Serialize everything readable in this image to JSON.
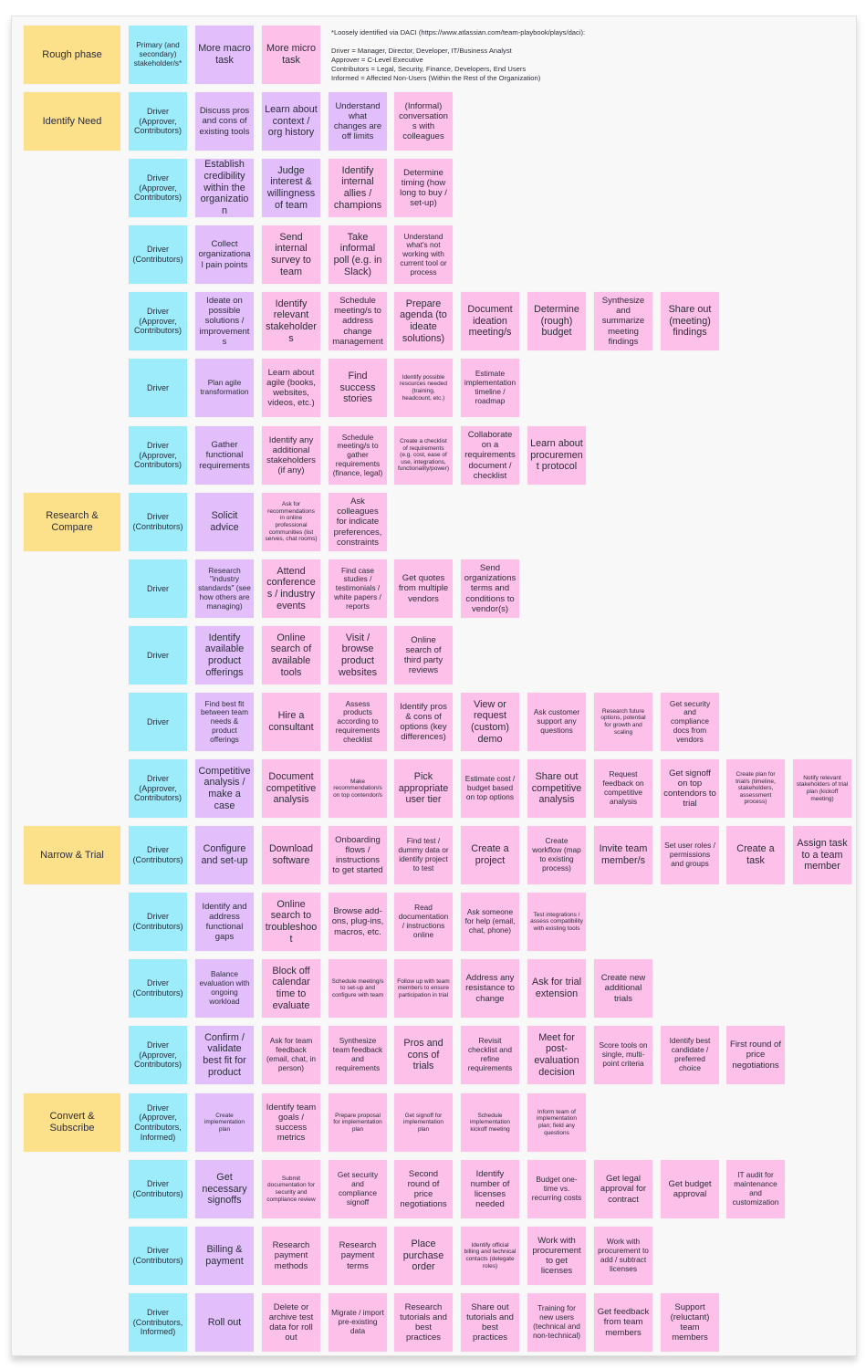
{
  "legend": {
    "title": "*Loosely identified via DACI (https://www.atlassian.com/team-playbook/plays/daci):",
    "lines": [
      "Driver = Manager, Director, Developer, IT/Business Analyst",
      "Approver = C-Level Executive",
      "Contributors = Legal, Security, Finance, Developers, End Users",
      "Informed = Affected Non-Users (Within the Rest of the Organization)"
    ]
  },
  "colors": {
    "phase": "#fde08a",
    "stakeholder": "#9cecfb",
    "macro_task": "#e2bffb",
    "micro_task": "#fdc0e8",
    "board": "#f8f8f8"
  },
  "header": {
    "phase": "Rough phase",
    "stakeholder": "Primary (and secondary) stakeholder/s*",
    "macro": "More macro task",
    "micro": "More micro task"
  },
  "rows": [
    {
      "phase": "Identify Need",
      "stakeholder": "Driver (Approver, Contributors)",
      "tasks": [
        {
          "text": "Discuss pros and cons of existing tools",
          "type": "macro",
          "size": "md"
        },
        {
          "text": "Learn about context / org history",
          "type": "macro",
          "size": "lg"
        },
        {
          "text": "Understand what changes are off limits",
          "type": "macro",
          "size": "md"
        },
        {
          "text": "(Informal) conversations with colleagues",
          "type": "micro",
          "size": "md"
        }
      ]
    },
    {
      "phase": "",
      "stakeholder": "Driver (Approver, Contributors)",
      "tasks": [
        {
          "text": "Establish credibility within the organization",
          "type": "macro",
          "size": "lg"
        },
        {
          "text": "Judge interest & willingness of team",
          "type": "macro",
          "size": "lg"
        },
        {
          "text": "Identify internal allies / champions",
          "type": "micro",
          "size": "lg"
        },
        {
          "text": "Determine timing (how long to buy / set-up)",
          "type": "micro",
          "size": "md"
        }
      ]
    },
    {
      "phase": "",
      "stakeholder": "Driver (Contributors)",
      "tasks": [
        {
          "text": "Collect organizational pain points",
          "type": "macro",
          "size": "md"
        },
        {
          "text": "Send internal survey to team",
          "type": "micro",
          "size": "lg"
        },
        {
          "text": "Take informal poll (e.g. in Slack)",
          "type": "micro",
          "size": "lg"
        },
        {
          "text": "Understand what's not working with current tool or process",
          "type": "micro",
          "size": "sm"
        }
      ]
    },
    {
      "phase": "",
      "stakeholder": "Driver (Approver, Contributors)",
      "tasks": [
        {
          "text": "Ideate on possible solutions / improvements",
          "type": "macro",
          "size": "md"
        },
        {
          "text": "Identify relevant stakeholders",
          "type": "micro",
          "size": "lg"
        },
        {
          "text": "Schedule meeting/s to address change management",
          "type": "micro",
          "size": "md"
        },
        {
          "text": "Prepare agenda (to ideate solutions)",
          "type": "micro",
          "size": "lg"
        },
        {
          "text": "Document ideation meeting/s",
          "type": "micro",
          "size": "lg"
        },
        {
          "text": "Determine (rough) budget",
          "type": "micro",
          "size": "lg"
        },
        {
          "text": "Synthesize and summarize meeting findings",
          "type": "micro",
          "size": "md"
        },
        {
          "text": "Share out (meeting) findings",
          "type": "micro",
          "size": "lg"
        }
      ]
    },
    {
      "phase": "",
      "stakeholder": "Driver",
      "tasks": [
        {
          "text": "Plan agile transformation",
          "type": "macro",
          "size": "sm"
        },
        {
          "text": "Learn about agile (books, websites, videos, etc.)",
          "type": "micro",
          "size": "md"
        },
        {
          "text": "Find success stories",
          "type": "micro",
          "size": "lg"
        },
        {
          "text": "Identify possible resources needed (training, headcount, etc.)",
          "type": "micro",
          "size": "xs"
        },
        {
          "text": "Estimate implementation timeline / roadmap",
          "type": "micro",
          "size": "sm"
        }
      ]
    },
    {
      "phase": "",
      "stakeholder": "Driver (Approver, Contributors)",
      "tasks": [
        {
          "text": "Gather functional requirements",
          "type": "macro",
          "size": "md"
        },
        {
          "text": "Identify any additional stakeholders (if any)",
          "type": "micro",
          "size": "md"
        },
        {
          "text": "Schedule meeting/s to gather requirements (finance, legal)",
          "type": "micro",
          "size": "sm"
        },
        {
          "text": "Create a checklist of requirements (e.g. cost, ease of use, integrations, functionality/power)",
          "type": "micro",
          "size": "xs"
        },
        {
          "text": "Collaborate on a requirements document / checklist",
          "type": "micro",
          "size": "md"
        },
        {
          "text": "Learn about procurement protocol",
          "type": "micro",
          "size": "lg"
        }
      ]
    },
    {
      "phase": "Research & Compare",
      "stakeholder": "Driver (Contributors)",
      "tasks": [
        {
          "text": "Solicit advice",
          "type": "macro",
          "size": "lg"
        },
        {
          "text": "Ask for recommendations in online professional communities (list serves, chat rooms)",
          "type": "micro",
          "size": "xs"
        },
        {
          "text": "Ask colleagues for indicate preferences, constraints",
          "type": "micro",
          "size": "md"
        }
      ]
    },
    {
      "phase": "",
      "stakeholder": "Driver",
      "tasks": [
        {
          "text": "Research \"industry standards\" (see how others are managing)",
          "type": "macro",
          "size": "sm"
        },
        {
          "text": "Attend conferences / industry events",
          "type": "micro",
          "size": "lg"
        },
        {
          "text": "Find case studies / testimonials / white papers / reports",
          "type": "micro",
          "size": "sm"
        },
        {
          "text": "Get quotes from multiple vendors",
          "type": "micro",
          "size": "md"
        },
        {
          "text": "Send organizations terms and conditions to vendor(s)",
          "type": "micro",
          "size": "md"
        }
      ]
    },
    {
      "phase": "",
      "stakeholder": "Driver",
      "tasks": [
        {
          "text": "Identify available product offerings",
          "type": "macro",
          "size": "lg"
        },
        {
          "text": "Online search of available tools",
          "type": "micro",
          "size": "lg"
        },
        {
          "text": "Visit / browse product websites",
          "type": "micro",
          "size": "lg"
        },
        {
          "text": "Online search of third party reviews",
          "type": "micro",
          "size": "md"
        }
      ]
    },
    {
      "phase": "",
      "stakeholder": "Driver",
      "tasks": [
        {
          "text": "Find best fit between team needs & product offerings",
          "type": "macro",
          "size": "sm"
        },
        {
          "text": "Hire a consultant",
          "type": "micro",
          "size": "lg"
        },
        {
          "text": "Assess products according to requirements checklist",
          "type": "micro",
          "size": "sm"
        },
        {
          "text": "Identify pros & cons of options (key differences)",
          "type": "micro",
          "size": "md"
        },
        {
          "text": "View or request (custom) demo",
          "type": "micro",
          "size": "lg"
        },
        {
          "text": "Ask customer support any questions",
          "type": "micro",
          "size": "sm"
        },
        {
          "text": "Research future options, potential for growth and scaling",
          "type": "micro",
          "size": "xs"
        },
        {
          "text": "Get security and compliance docs from vendors",
          "type": "micro",
          "size": "sm"
        }
      ]
    },
    {
      "phase": "",
      "stakeholder": "Driver (Approver, Contributors)",
      "tasks": [
        {
          "text": "Competitive analysis / make a case",
          "type": "macro",
          "size": "lg"
        },
        {
          "text": "Document competitive analysis",
          "type": "micro",
          "size": "lg"
        },
        {
          "text": "Make recommendation/s on top contendor/s",
          "type": "micro",
          "size": "xs"
        },
        {
          "text": "Pick appropriate user tier",
          "type": "micro",
          "size": "lg"
        },
        {
          "text": "Estimate cost / budget based on top options",
          "type": "micro",
          "size": "sm"
        },
        {
          "text": "Share out competitive analysis",
          "type": "micro",
          "size": "lg"
        },
        {
          "text": "Request feedback on competitive analysis",
          "type": "micro",
          "size": "sm"
        },
        {
          "text": "Get signoff on top contendors to trial",
          "type": "micro",
          "size": "md"
        },
        {
          "text": "Create plan for trial/s (timeline, stakeholders, assessment process)",
          "type": "micro",
          "size": "xs"
        },
        {
          "text": "Notify relevant stakeholders of trial plan (kickoff meeting)",
          "type": "micro",
          "size": "xs"
        }
      ]
    },
    {
      "phase": "Narrow & Trial",
      "stakeholder": "Driver (Contributors)",
      "tasks": [
        {
          "text": "Configure and set-up",
          "type": "macro",
          "size": "lg"
        },
        {
          "text": "Download software",
          "type": "micro",
          "size": "lg"
        },
        {
          "text": "Onboarding flows / instructions to get started",
          "type": "micro",
          "size": "md"
        },
        {
          "text": "Find test / dummy data or identify project to test",
          "type": "micro",
          "size": "sm"
        },
        {
          "text": "Create a project",
          "type": "micro",
          "size": "lg"
        },
        {
          "text": "Create workflow (map to existing process)",
          "type": "micro",
          "size": "sm"
        },
        {
          "text": "Invite team member/s",
          "type": "micro",
          "size": "lg"
        },
        {
          "text": "Set user roles / permissions and groups",
          "type": "micro",
          "size": "sm"
        },
        {
          "text": "Create a task",
          "type": "micro",
          "size": "lg"
        },
        {
          "text": "Assign task to a team member",
          "type": "micro",
          "size": "lg"
        }
      ]
    },
    {
      "phase": "",
      "stakeholder": "Driver (Contributors)",
      "tasks": [
        {
          "text": "Identify and address functional gaps",
          "type": "macro",
          "size": "md"
        },
        {
          "text": "Online search to troubleshoot",
          "type": "micro",
          "size": "lg"
        },
        {
          "text": "Browse add-ons, plug-ins, macros, etc.",
          "type": "micro",
          "size": "md"
        },
        {
          "text": "Read documentation / instructions online",
          "type": "micro",
          "size": "sm"
        },
        {
          "text": "Ask someone for help (email, chat, phone)",
          "type": "micro",
          "size": "sm"
        },
        {
          "text": "Test integrations / assess compatibility with existing tools",
          "type": "micro",
          "size": "xs"
        }
      ]
    },
    {
      "phase": "",
      "stakeholder": "Driver (Contributors)",
      "tasks": [
        {
          "text": "Balance evaluation with ongoing workload",
          "type": "macro",
          "size": "sm"
        },
        {
          "text": "Block off calendar time to evaluate",
          "type": "micro",
          "size": "lg"
        },
        {
          "text": "Schedule meeting/s to set-up and configure with team",
          "type": "micro",
          "size": "xs"
        },
        {
          "text": "Follow up with team members to ensure participation in trial",
          "type": "micro",
          "size": "xs"
        },
        {
          "text": "Address any resistance to change",
          "type": "micro",
          "size": "md"
        },
        {
          "text": "Ask for trial extension",
          "type": "micro",
          "size": "lg"
        },
        {
          "text": "Create new additional trials",
          "type": "micro",
          "size": "md"
        }
      ]
    },
    {
      "phase": "",
      "stakeholder": "Driver (Approver, Contributors)",
      "tasks": [
        {
          "text": "Confirm / validate best fit for product",
          "type": "macro",
          "size": "lg"
        },
        {
          "text": "Ask for team feedback (email, chat, in person)",
          "type": "micro",
          "size": "sm"
        },
        {
          "text": "Synthesize team feedback and requirements",
          "type": "micro",
          "size": "sm"
        },
        {
          "text": "Pros and cons of trials",
          "type": "micro",
          "size": "lg"
        },
        {
          "text": "Revisit checklist and refine requirements",
          "type": "micro",
          "size": "sm"
        },
        {
          "text": "Meet for post-evaluation decision",
          "type": "micro",
          "size": "lg"
        },
        {
          "text": "Score tools on single, multi-point criteria",
          "type": "micro",
          "size": "sm"
        },
        {
          "text": "Identify best candidate / preferred choice",
          "type": "micro",
          "size": "sm"
        },
        {
          "text": "First round of price negotiations",
          "type": "micro",
          "size": "md"
        }
      ]
    },
    {
      "phase": "Convert & Subscribe",
      "stakeholder": "Driver (Approver, Contributors, Informed)",
      "tasks": [
        {
          "text": "Create implementation plan",
          "type": "macro",
          "size": "xs"
        },
        {
          "text": "Identify team goals / success metrics",
          "type": "micro",
          "size": "md"
        },
        {
          "text": "Prepare proposal for implementation plan",
          "type": "micro",
          "size": "xs"
        },
        {
          "text": "Get signoff for implementation plan",
          "type": "micro",
          "size": "xs"
        },
        {
          "text": "Schedule implementation kickoff meeting",
          "type": "micro",
          "size": "xs"
        },
        {
          "text": "Inform team of implementation plan; field any questions",
          "type": "micro",
          "size": "xs"
        }
      ]
    },
    {
      "phase": "",
      "stakeholder": "Driver (Contributors)",
      "tasks": [
        {
          "text": "Get necessary signoffs",
          "type": "macro",
          "size": "lg"
        },
        {
          "text": "Submit documentation for security and compliance review",
          "type": "micro",
          "size": "xs"
        },
        {
          "text": "Get security and compliance signoff",
          "type": "micro",
          "size": "sm"
        },
        {
          "text": "Second round of price negotiations",
          "type": "micro",
          "size": "md"
        },
        {
          "text": "Identify number of licenses needed",
          "type": "micro",
          "size": "md"
        },
        {
          "text": "Budget one-time vs. recurring costs",
          "type": "micro",
          "size": "sm"
        },
        {
          "text": "Get legal approval for contract",
          "type": "micro",
          "size": "md"
        },
        {
          "text": "Get budget approval",
          "type": "micro",
          "size": "md"
        },
        {
          "text": "IT audit for maintenance and customization",
          "type": "micro",
          "size": "sm"
        }
      ]
    },
    {
      "phase": "",
      "stakeholder": "Driver (Contributors)",
      "tasks": [
        {
          "text": "Billing & payment",
          "type": "macro",
          "size": "lg"
        },
        {
          "text": "Research payment methods",
          "type": "micro",
          "size": "md"
        },
        {
          "text": "Research payment terms",
          "type": "micro",
          "size": "md"
        },
        {
          "text": "Place purchase order",
          "type": "micro",
          "size": "lg"
        },
        {
          "text": "Identify official billing and technical contacts (delegate roles)",
          "type": "micro",
          "size": "xs"
        },
        {
          "text": "Work with procurement to get licenses",
          "type": "micro",
          "size": "md"
        },
        {
          "text": "Work with procurement to add / subtract licenses",
          "type": "micro",
          "size": "sm"
        }
      ]
    },
    {
      "phase": "",
      "stakeholder": "Driver (Contributors, Informed)",
      "tasks": [
        {
          "text": "Roll out",
          "type": "macro",
          "size": "lg"
        },
        {
          "text": "Delete or archive test data for roll out",
          "type": "micro",
          "size": "md"
        },
        {
          "text": "Migrate / import pre-existing data",
          "type": "micro",
          "size": "sm"
        },
        {
          "text": "Research tutorials and best practices",
          "type": "micro",
          "size": "md"
        },
        {
          "text": "Share out tutorials and best practices",
          "type": "micro",
          "size": "md"
        },
        {
          "text": "Training for new users (technical and non-technical)",
          "type": "micro",
          "size": "sm"
        },
        {
          "text": "Get feedback from team members",
          "type": "micro",
          "size": "md"
        },
        {
          "text": "Support (reluctant) team members",
          "type": "micro",
          "size": "md"
        }
      ]
    }
  ]
}
